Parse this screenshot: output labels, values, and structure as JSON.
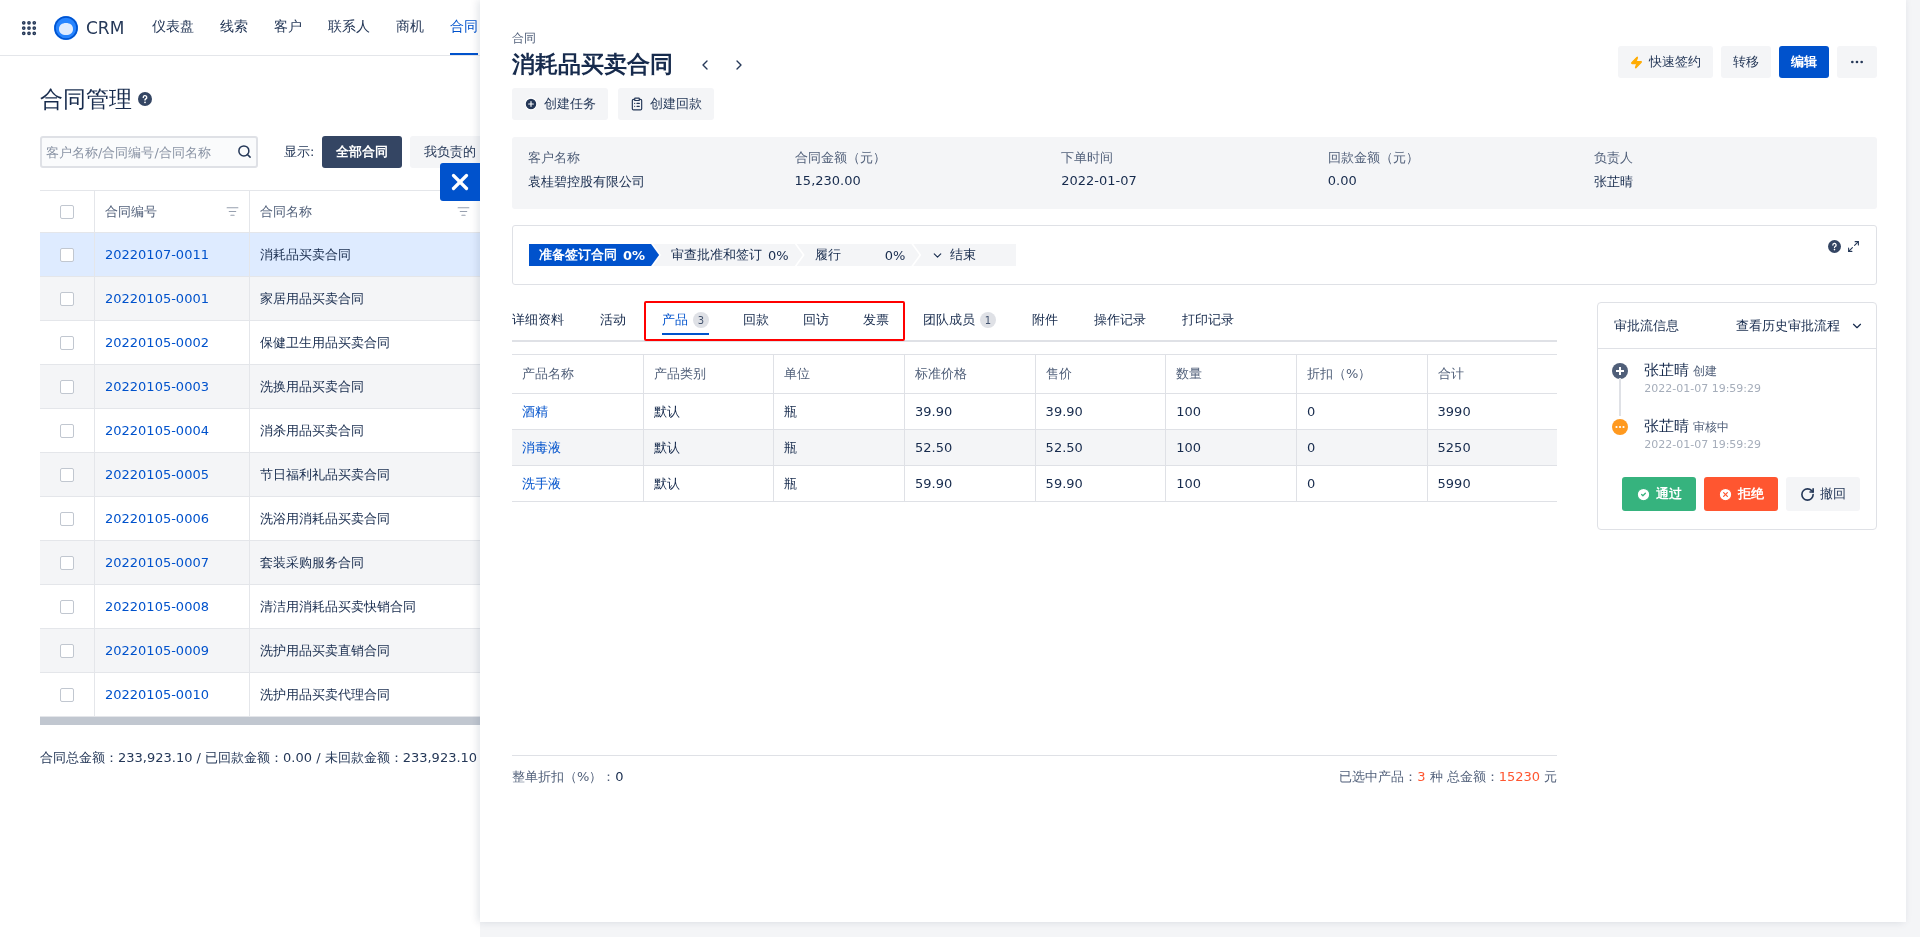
{
  "nav": {
    "logo": "CRM",
    "items": [
      {
        "label": "仪表盘",
        "selected": false
      },
      {
        "label": "线索",
        "selected": false
      },
      {
        "label": "客户",
        "selected": false
      },
      {
        "label": "联系人",
        "selected": false
      },
      {
        "label": "商机",
        "selected": false
      },
      {
        "label": "合同",
        "selected": true
      }
    ]
  },
  "list_page": {
    "title": "合同管理",
    "search": {
      "placeholder": "客户名称/合同编号/合同名称"
    },
    "filter_label": "显示:",
    "filters": [
      {
        "label": "全部合同",
        "selected": true
      },
      {
        "label": "我负责的",
        "selected": false
      }
    ],
    "table": {
      "all_checked": false,
      "columns": [
        "合同编号",
        "合同名称"
      ],
      "rows": [
        {
          "code": "20220107-0011",
          "name": "消耗品买卖合同",
          "selected": true,
          "checked": false
        },
        {
          "code": "20220105-0001",
          "name": "家居用品买卖合同",
          "selected": false,
          "checked": false
        },
        {
          "code": "20220105-0002",
          "name": "保健卫生用品买卖合同",
          "selected": false,
          "checked": false
        },
        {
          "code": "20220105-0003",
          "name": "洗换用品买卖合同",
          "selected": false,
          "checked": false
        },
        {
          "code": "20220105-0004",
          "name": "消杀用品买卖合同",
          "selected": false,
          "checked": false
        },
        {
          "code": "20220105-0005",
          "name": "节日福利礼品买卖合同",
          "selected": false,
          "checked": false
        },
        {
          "code": "20220105-0006",
          "name": "洗浴用消耗品买卖合同",
          "selected": false,
          "checked": false
        },
        {
          "code": "20220105-0007",
          "name": "套装采购服务合同",
          "selected": false,
          "checked": false
        },
        {
          "code": "20220105-0008",
          "name": "清洁用消耗品买卖快销合同",
          "selected": false,
          "checked": false
        },
        {
          "code": "20220105-0009",
          "name": "洗护用品买卖直销合同",
          "selected": false,
          "checked": false
        },
        {
          "code": "20220105-0010",
          "name": "洗护用品买卖代理合同",
          "selected": false,
          "checked": false
        }
      ]
    },
    "footer": "合同总金额：233,923.10 / 已回款金额：0.00 / 未回款金额：233,923.10"
  },
  "drawer": {
    "breadcrumb": "合同",
    "title": "消耗品买卖合同",
    "header_buttons": [
      {
        "label": "快速签约",
        "kind": "quick"
      },
      {
        "label": "转移",
        "kind": "plain"
      },
      {
        "label": "编辑",
        "kind": "primary"
      },
      {
        "kind": "more"
      }
    ],
    "actions": [
      {
        "label": "创建任务",
        "kind": "task"
      },
      {
        "label": "创建回款",
        "kind": "payment"
      }
    ],
    "summary": [
      {
        "label": "客户名称",
        "value": "袁桂碧控股有限公司"
      },
      {
        "label": "合同金额（元）",
        "value": "15,230.00"
      },
      {
        "label": "下单时间",
        "value": "2022-01-07"
      },
      {
        "label": "回款金额（元）",
        "value": "0.00"
      },
      {
        "label": "负责人",
        "value": "张芷晴"
      }
    ],
    "stages": [
      {
        "label": "准备签订合同",
        "percent": "0%",
        "current": true
      },
      {
        "label": "审查批准和签订",
        "percent": "0%",
        "current": false
      },
      {
        "label": "履行",
        "percent": "0%",
        "current": false
      },
      {
        "label": "结束",
        "current": false
      }
    ],
    "tabs": [
      {
        "label": "详细资料",
        "selected": false,
        "highlighted": false
      },
      {
        "label": "活动",
        "selected": false,
        "highlighted": false
      },
      {
        "label": "产品",
        "count": "3",
        "selected": true,
        "highlighted": true
      },
      {
        "label": "回款",
        "selected": false,
        "highlighted": true
      },
      {
        "label": "回访",
        "selected": false,
        "highlighted": true
      },
      {
        "label": "发票",
        "selected": false,
        "highlighted": true
      },
      {
        "label": "团队成员",
        "count": "1",
        "selected": false,
        "highlighted": false
      },
      {
        "label": "附件",
        "selected": false,
        "highlighted": false
      },
      {
        "label": "操作记录",
        "selected": false,
        "highlighted": false
      },
      {
        "label": "打印记录",
        "selected": false,
        "highlighted": false
      }
    ],
    "products": {
      "columns": [
        "产品名称",
        "产品类别",
        "单位",
        "标准价格",
        "售价",
        "数量",
        "折扣（%）",
        "合计"
      ],
      "rows": [
        [
          "酒精",
          "默认",
          "瓶",
          "39.90",
          "39.90",
          "100",
          "0",
          "3990"
        ],
        [
          "消毒液",
          "默认",
          "瓶",
          "52.50",
          "52.50",
          "100",
          "0",
          "5250"
        ],
        [
          "洗手液",
          "默认",
          "瓶",
          "59.90",
          "59.90",
          "100",
          "0",
          "5990"
        ]
      ]
    },
    "footer": {
      "discount_label": "整单折扣（%）：",
      "discount_value": "0",
      "selected_label": "已选中产品：",
      "selected_count": "3",
      "selected_unit": "种",
      "total_label": "总金额：",
      "total": "15230",
      "currency": "元"
    },
    "approval": {
      "title": "审批流信息",
      "history_link": "查看历史审批流程",
      "steps": [
        {
          "name": "张芷晴",
          "action": "创建",
          "time": "2022-01-07 19:59:29",
          "kind": "created"
        },
        {
          "name": "张芷晴",
          "action": "审核中",
          "time": "2022-01-07 19:59:29",
          "kind": "pending"
        }
      ],
      "buttons": [
        {
          "label": "通过",
          "kind": "approve"
        },
        {
          "label": "拒绝",
          "kind": "reject"
        },
        {
          "label": "撤回",
          "kind": "withdraw"
        }
      ]
    }
  }
}
